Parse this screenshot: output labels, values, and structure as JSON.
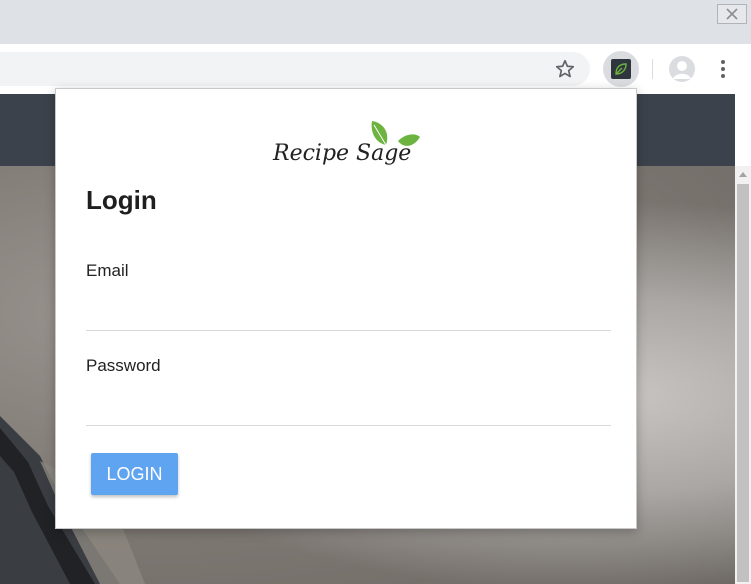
{
  "browser": {
    "close_icon": "close-x",
    "bookmark_icon": "star-outline",
    "extension_icon": "recipe-sage-leaf",
    "profile_icon": "avatar",
    "menu_icon": "vertical-dots"
  },
  "popup": {
    "logo_text": "Recipe Sage",
    "title": "Login",
    "email_label": "Email",
    "email_value": "",
    "password_label": "Password",
    "password_value": "",
    "login_button": "LOGIN"
  },
  "colors": {
    "header": "#3c424b",
    "button": "#5fa4f0",
    "leaf": "#6db33f"
  }
}
